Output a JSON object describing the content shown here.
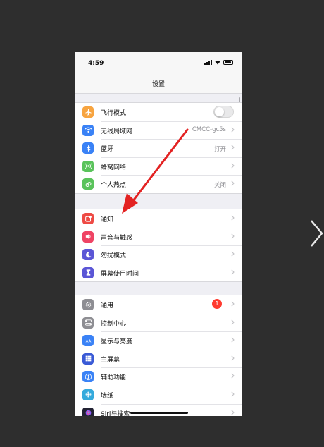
{
  "status_bar": {
    "time": "4:59"
  },
  "nav": {
    "title": "设置"
  },
  "groups": [
    {
      "rows": [
        {
          "label": "飞行模式",
          "icon": "airplane-icon",
          "icon_color": "#f7a440",
          "control": "toggle",
          "toggle_on": false
        },
        {
          "label": "无线局域网",
          "icon": "wifi-icon",
          "icon_color": "#3a82f6",
          "value": "CMCC-gc5s"
        },
        {
          "label": "蓝牙",
          "icon": "bluetooth-icon",
          "icon_color": "#3a82f6",
          "value": "打开"
        },
        {
          "label": "蜂窝网络",
          "icon": "cellular-icon",
          "icon_color": "#5ac35b"
        },
        {
          "label": "个人热点",
          "icon": "hotspot-icon",
          "icon_color": "#5ac35b",
          "value": "关闭"
        }
      ]
    },
    {
      "rows": [
        {
          "label": "通知",
          "icon": "notifications-icon",
          "icon_color": "#ee4a44"
        },
        {
          "label": "声音与触感",
          "icon": "sound-icon",
          "icon_color": "#ef4464"
        },
        {
          "label": "勿扰模式",
          "icon": "moon-icon",
          "icon_color": "#5b56d6"
        },
        {
          "label": "屏幕使用时间",
          "icon": "hourglass-icon",
          "icon_color": "#5b56d6"
        }
      ]
    },
    {
      "rows": [
        {
          "label": "通用",
          "icon": "gear-icon",
          "icon_color": "#8e8e93",
          "badge": "1"
        },
        {
          "label": "控制中心",
          "icon": "control-center-icon",
          "icon_color": "#8e8e93"
        },
        {
          "label": "显示与亮度",
          "icon": "display-icon",
          "icon_color": "#3a82f6"
        },
        {
          "label": "主屏幕",
          "icon": "home-screen-icon",
          "icon_color": "#3a5ad6"
        },
        {
          "label": "辅助功能",
          "icon": "accessibility-icon",
          "icon_color": "#3a82f6"
        },
        {
          "label": "墙纸",
          "icon": "wallpaper-icon",
          "icon_color": "#35aadc"
        },
        {
          "label": "Siri与搜索",
          "icon": "siri-icon",
          "icon_color": "#222233"
        }
      ]
    }
  ],
  "annotation": {
    "arrow_color": "#e32222",
    "target": "通知"
  }
}
